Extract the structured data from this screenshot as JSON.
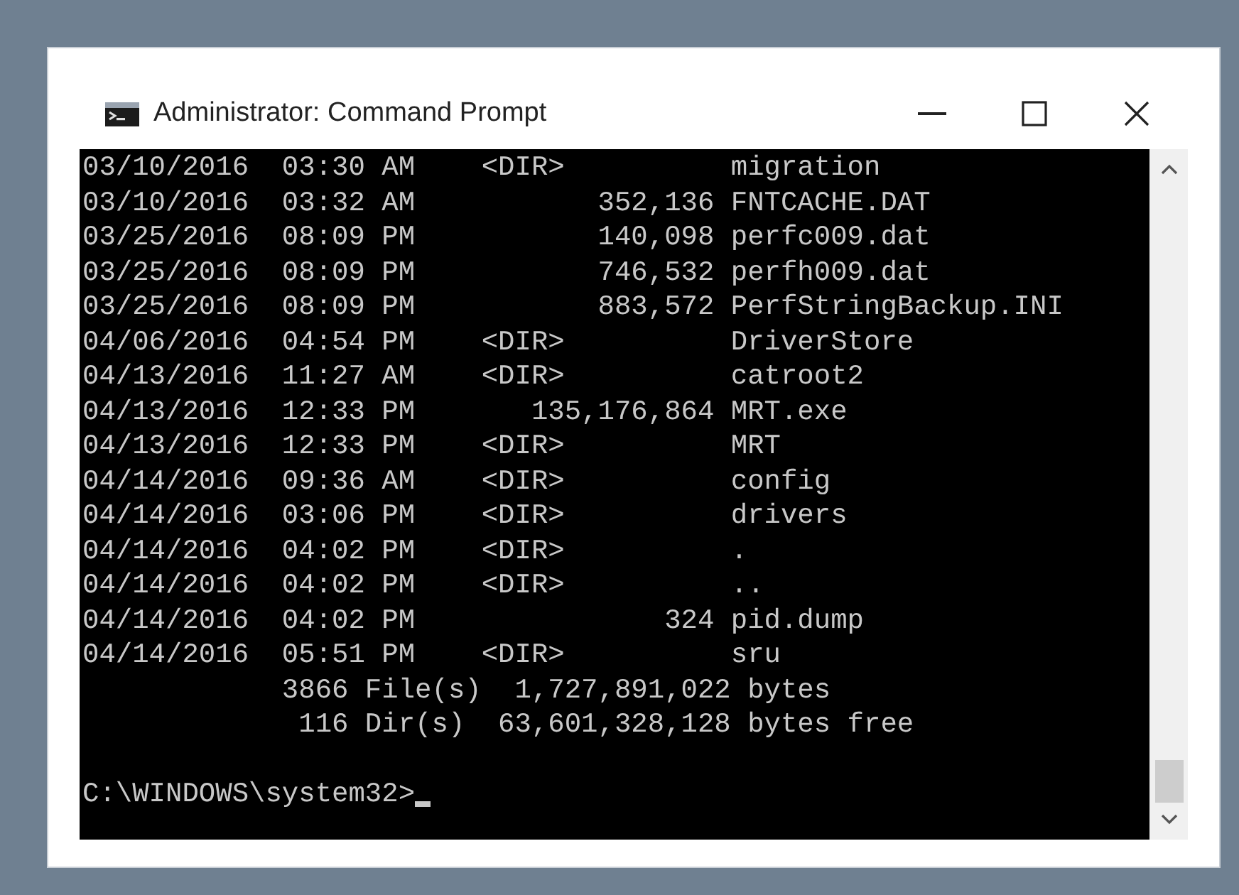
{
  "window": {
    "title": "Administrator: Command Prompt"
  },
  "console": {
    "lines": [
      "03/10/2016  03:30 AM    <DIR>          migration",
      "03/10/2016  03:32 AM           352,136 FNTCACHE.DAT",
      "03/25/2016  08:09 PM           140,098 perfc009.dat",
      "03/25/2016  08:09 PM           746,532 perfh009.dat",
      "03/25/2016  08:09 PM           883,572 PerfStringBackup.INI",
      "04/06/2016  04:54 PM    <DIR>          DriverStore",
      "04/13/2016  11:27 AM    <DIR>          catroot2",
      "04/13/2016  12:33 PM       135,176,864 MRT.exe",
      "04/13/2016  12:33 PM    <DIR>          MRT",
      "04/14/2016  09:36 AM    <DIR>          config",
      "04/14/2016  03:06 PM    <DIR>          drivers",
      "04/14/2016  04:02 PM    <DIR>          .",
      "04/14/2016  04:02 PM    <DIR>          ..",
      "04/14/2016  04:02 PM               324 pid.dump",
      "04/14/2016  05:51 PM    <DIR>          sru",
      "            3866 File(s)  1,727,891,022 bytes",
      "             116 Dir(s)  63,601,328,128 bytes free"
    ],
    "prompt": "C:\\WINDOWS\\system32>"
  }
}
